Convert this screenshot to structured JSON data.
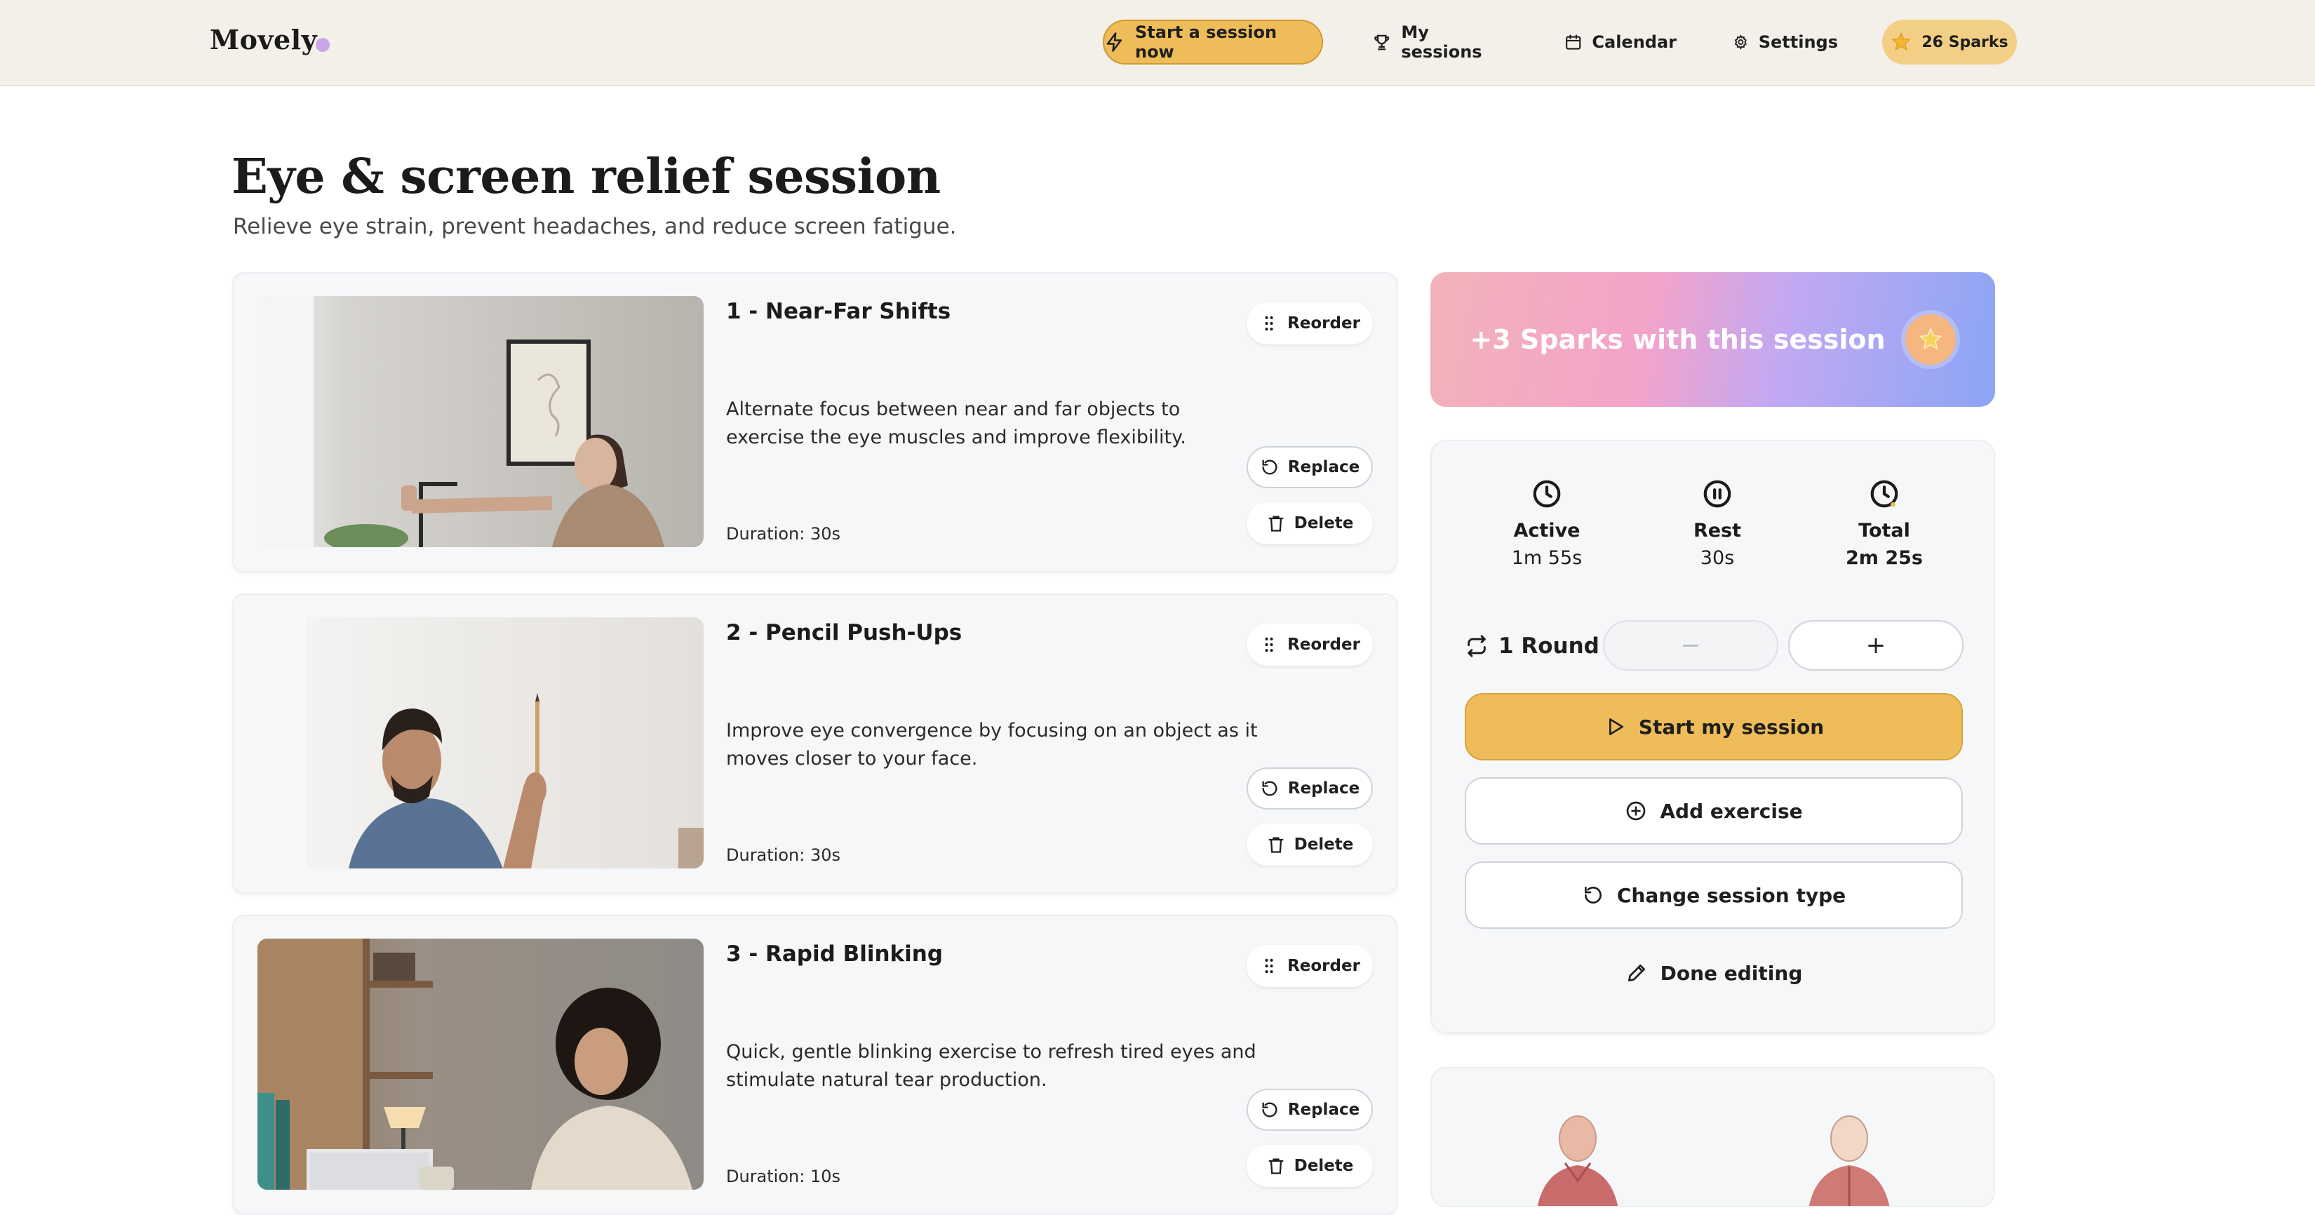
{
  "header": {
    "logo": "Movely",
    "nav": {
      "start": "Start a session now",
      "sessions": "My sessions",
      "calendar": "Calendar",
      "settings": "Settings",
      "sparks": "26 Sparks"
    }
  },
  "page": {
    "title": "Eye & screen relief session",
    "subtitle": "Relieve eye strain, prevent headaches, and reduce screen fatigue."
  },
  "exercises": [
    {
      "title": "1 - Near-Far Shifts",
      "description": "Alternate focus between near and far objects to exercise the eye muscles and improve flexibility.",
      "duration": "Duration: 30s"
    },
    {
      "title": "2 - Pencil Push-Ups",
      "description": "Improve eye convergence by focusing on an object as it moves closer to your face.",
      "duration": "Duration: 30s"
    },
    {
      "title": "3 - Rapid Blinking",
      "description": "Quick, gentle blinking exercise to refresh tired eyes and stimulate natural tear production.",
      "duration": "Duration: 10s"
    }
  ],
  "card_actions": {
    "reorder": "Reorder",
    "replace": "Replace",
    "delete": "Delete"
  },
  "sidebar": {
    "sparks_banner": "+3 Sparks with this session",
    "stats": {
      "active_label": "Active",
      "active_value": "1m 55s",
      "rest_label": "Rest",
      "rest_value": "30s",
      "total_label": "Total",
      "total_value": "2m 25s"
    },
    "rounds": "1 Round",
    "decrement": "−",
    "increment": "+",
    "start": "Start my session",
    "add": "Add exercise",
    "change": "Change session type",
    "done": "Done editing"
  },
  "colors": {
    "accent": "#efbc5a",
    "header_bg": "#f3f0e9",
    "card_bg": "#f6f7f9"
  }
}
